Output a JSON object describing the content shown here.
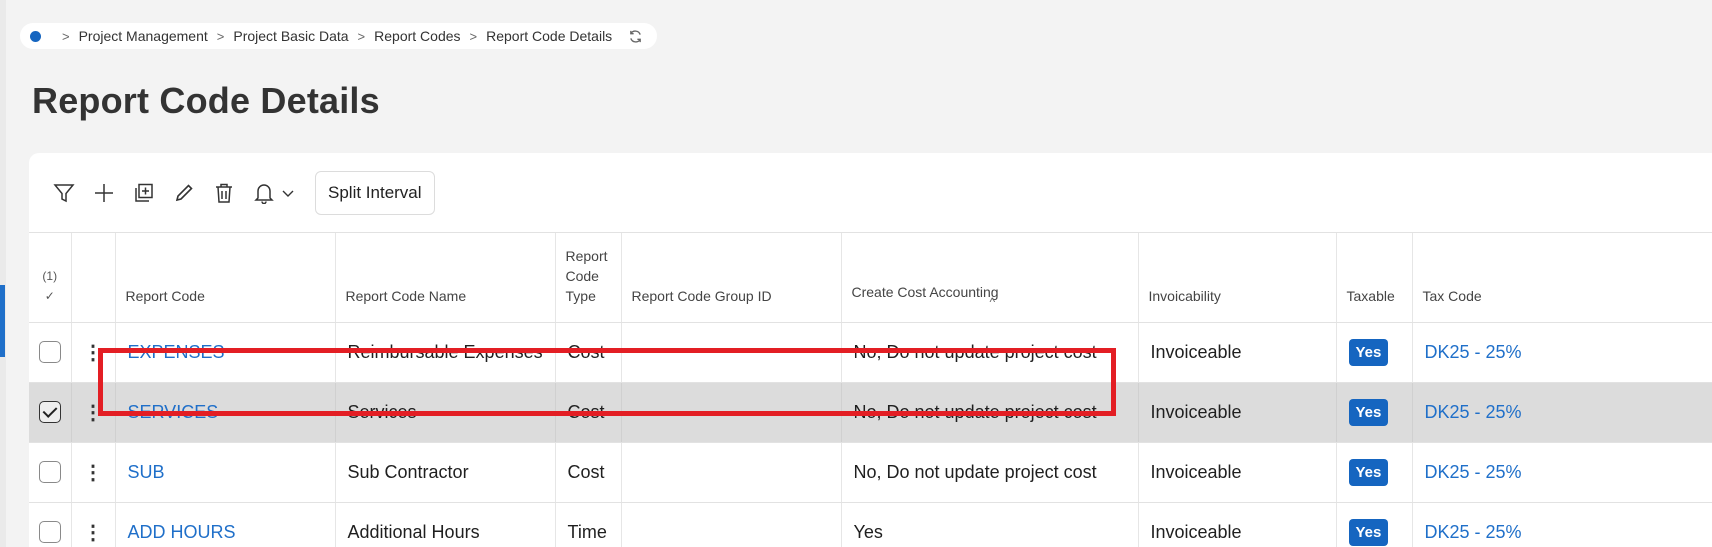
{
  "breadcrumb": {
    "items": [
      "Project Management",
      "Project Basic Data",
      "Report Codes",
      "Report Code Details"
    ],
    "separator": ">"
  },
  "page": {
    "title": "Report Code Details"
  },
  "toolbar": {
    "icons": [
      "filter-icon",
      "add-icon",
      "duplicate-icon",
      "edit-icon",
      "delete-icon",
      "bell-icon",
      "chevron-down-icon"
    ],
    "split_interval_label": "Split Interval"
  },
  "table": {
    "selected_count": "(1)",
    "columns": {
      "report_code": "Report Code",
      "report_code_name": "Report Code Name",
      "report_code_type_1": "Report",
      "report_code_type_2": "Code",
      "report_code_type_3": "Type",
      "report_code_group_id": "Report Code Group ID",
      "create_cost_accounting": "Create Cost Accounting",
      "invoicability": "Invoicability",
      "taxable": "Taxable",
      "tax_code": "Tax Code"
    },
    "rows": [
      {
        "code": "EXPENSES",
        "name": "Reimbursable Expenses",
        "type": "Cost",
        "group": "",
        "cost_accounting": "No, Do not update project cost",
        "invoicability": "Invoiceable",
        "taxable": "Yes",
        "tax_code": "DK25 - 25%",
        "selected": false
      },
      {
        "code": "SERVICES",
        "name": "Services",
        "type": "Cost",
        "group": "",
        "cost_accounting": "No, Do not update project cost",
        "invoicability": "Invoiceable",
        "taxable": "Yes",
        "tax_code": "DK25 - 25%",
        "selected": true
      },
      {
        "code": "SUB",
        "name": "Sub Contractor",
        "type": "Cost",
        "group": "",
        "cost_accounting": "No, Do not update project cost",
        "invoicability": "Invoiceable",
        "taxable": "Yes",
        "tax_code": "DK25 - 25%",
        "selected": false
      },
      {
        "code": "ADD HOURS",
        "name": "Additional Hours",
        "type": "Time",
        "group": "",
        "cost_accounting": "Yes",
        "invoicability": "Invoiceable",
        "taxable": "Yes",
        "tax_code": "DK25 - 25%",
        "selected": false
      }
    ]
  },
  "colors": {
    "link": "#1f6fc9",
    "badge": "#1565c0",
    "highlight": "#e31e24",
    "selected_row": "#dcdcdc"
  }
}
